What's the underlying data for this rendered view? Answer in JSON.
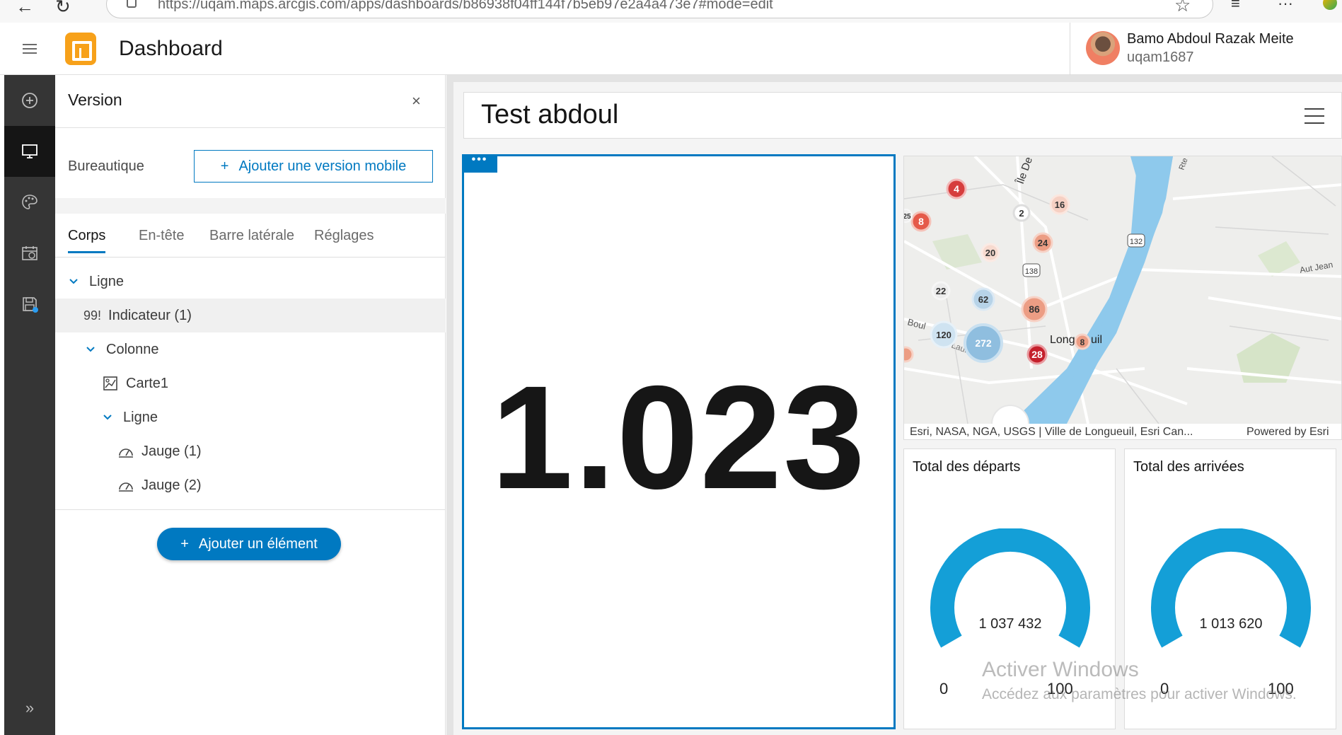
{
  "browser": {
    "url": "https://uqam.maps.arcgis.com/apps/dashboards/b86938f04ff144f7b5eb97e2a4a473e7#mode=edit"
  },
  "header": {
    "app_title": "Dashboard",
    "user_name": "Bamo Abdoul Razak Meite",
    "user_id": "uqam1687"
  },
  "panel": {
    "title": "Version",
    "close_glyph": "×",
    "version_label": "Bureautique",
    "add_mobile_label": "Ajouter une version mobile",
    "plus_glyph": "+",
    "tabs": [
      {
        "label": "Corps"
      },
      {
        "label": "En-tête"
      },
      {
        "label": "Barre latérale"
      },
      {
        "label": "Réglages"
      }
    ],
    "tree": [
      {
        "label": "Ligne"
      },
      {
        "prefix": "99!",
        "label": "Indicateur (1)"
      },
      {
        "label": "Colonne"
      },
      {
        "label": "Carte1"
      },
      {
        "label": "Ligne"
      },
      {
        "label": "Jauge (1)"
      },
      {
        "label": "Jauge (2)"
      }
    ],
    "add_element_label": "Ajouter un élément"
  },
  "rail": {
    "icons": [
      "add-icon",
      "desktop-icon",
      "palette-icon",
      "calendar-refresh-icon",
      "save-icon"
    ],
    "collapse_glyph": "»"
  },
  "dashboard": {
    "title": "Test abdoul",
    "indicator": {
      "tag": "•••",
      "value": "1.023"
    },
    "map": {
      "attribution": "Esri, NASA, NGA, USGS | Ville de Longueuil, Esri Can...",
      "powered_by": "Powered by Esri",
      "labels": [
        "Île De",
        "Rte 132",
        "Aut Jean",
        "Boul",
        "Laurent",
        "Long",
        "uil"
      ],
      "shields": [
        "132",
        "138"
      ],
      "clusters": [
        "4",
        "8",
        "2",
        "16",
        "24",
        "20",
        "22",
        "62",
        "86",
        "120",
        "272",
        "28",
        "8",
        "25"
      ],
      "colors": {
        "water": "#8ec9ec",
        "land": "#eeeeec",
        "red": "#d63d3d",
        "salmon": "#ec9d84",
        "blue": "#8fbedf"
      }
    },
    "gauges": [
      {
        "title": "Total des départs",
        "value": "1 037 432",
        "min": "0",
        "max": "100",
        "fraction": 1.0
      },
      {
        "title": "Total des arrivées",
        "value": "1 013 620",
        "min": "0",
        "max": "100",
        "fraction": 1.0
      }
    ],
    "accent_color": "#0079c1",
    "gauge_color": "#149fd7"
  },
  "watermark": {
    "line1": "Activer Windows",
    "line2": "Accédez aux paramètres pour activer Windows."
  }
}
